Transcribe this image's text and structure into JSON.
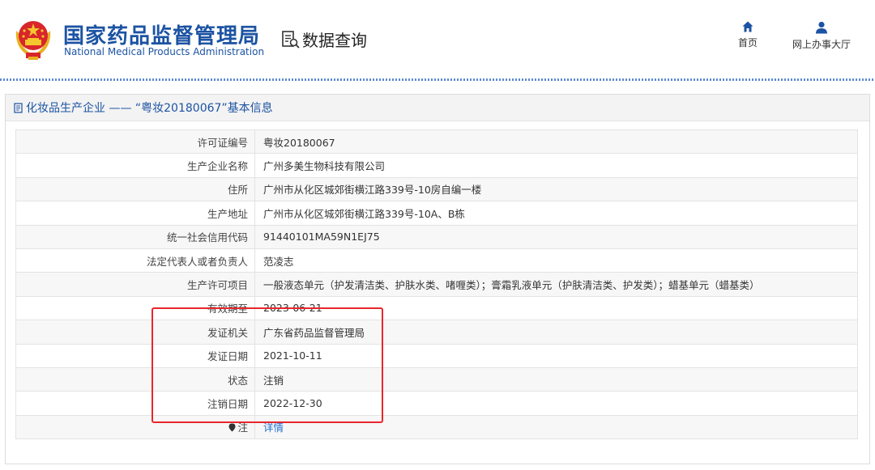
{
  "header": {
    "org_name_cn": "国家药品监督管理局",
    "org_name_en": "National Medical Products Administration",
    "section_title": "数据查询",
    "nav": [
      {
        "label": "首页",
        "icon": "home-icon"
      },
      {
        "label": "网上办事大厅",
        "icon": "user-icon"
      }
    ]
  },
  "panel": {
    "title": "化妆品生产企业 —— “粤妆20180067”基本信息",
    "rows": [
      {
        "label": "许可证编号",
        "value": "粤妆20180067"
      },
      {
        "label": "生产企业名称",
        "value": "广州多美生物科技有限公司"
      },
      {
        "label": "住所",
        "value": "广州市从化区城郊街横江路339号-10房自编一楼"
      },
      {
        "label": "生产地址",
        "value": "广州市从化区城郊街横江路339号-10A、B栋"
      },
      {
        "label": "统一社会信用代码",
        "value": "91440101MA59N1EJ75"
      },
      {
        "label": "法定代表人或者负责人",
        "value": "范凌志"
      },
      {
        "label": "生产许可项目",
        "value": "一般液态单元（护发清洁类、护肤水类、啫喱类）；膏霜乳液单元（护肤清洁类、护发类）；蜡基单元（蜡基类）"
      },
      {
        "label": "有效期至",
        "value": "2023-06-21"
      },
      {
        "label": "发证机关",
        "value": "广东省药品监督管理局"
      },
      {
        "label": "发证日期",
        "value": "2021-10-11"
      },
      {
        "label": "状态",
        "value": "注销"
      },
      {
        "label": "注销日期",
        "value": "2022-12-30"
      },
      {
        "label": "注",
        "value": "详情"
      }
    ]
  },
  "colors": {
    "brand": "#1c53a3",
    "highlight": "#e8262d",
    "link": "#1f6fd1"
  }
}
